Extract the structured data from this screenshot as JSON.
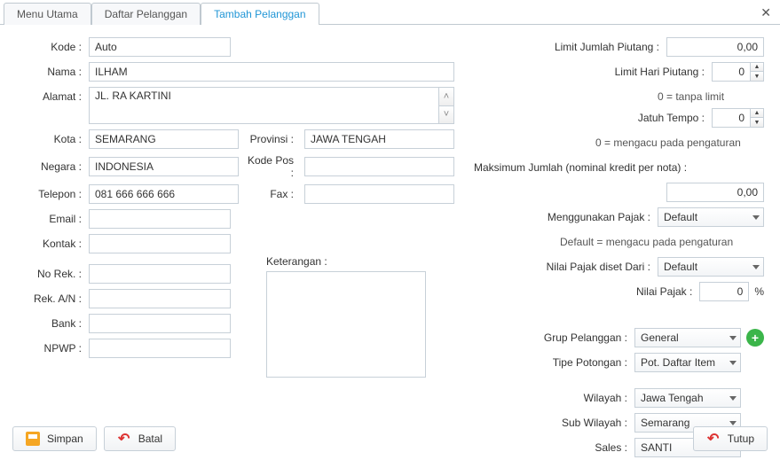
{
  "tabs": {
    "menu": "Menu Utama",
    "daftar": "Daftar Pelanggan",
    "tambah": "Tambah Pelanggan"
  },
  "labels": {
    "kode": "Kode :",
    "nama": "Nama :",
    "alamat": "Alamat :",
    "kota": "Kota :",
    "provinsi": "Provinsi :",
    "negara": "Negara :",
    "kodepos": "Kode Pos :",
    "telepon": "Telepon :",
    "fax": "Fax :",
    "email": "Email :",
    "kontak": "Kontak :",
    "norek": "No Rek. :",
    "rekan": "Rek. A/N :",
    "bank": "Bank :",
    "npwp": "NPWP :",
    "keterangan": "Keterangan :",
    "limit_jumlah": "Limit Jumlah Piutang :",
    "limit_hari": "Limit Hari Piutang :",
    "jatuh_tempo": "Jatuh Tempo :",
    "maks_jumlah_line": "Maksimum Jumlah (nominal kredit per nota) :",
    "menggunakan_pajak": "Menggunakan Pajak :",
    "nilai_pajak_dari": "Nilai Pajak diset Dari :",
    "nilai_pajak": "Nilai Pajak :",
    "grup": "Grup Pelanggan :",
    "tipe_potongan": "Tipe Potongan :",
    "wilayah": "Wilayah :",
    "sub_wilayah": "Sub Wilayah :",
    "sales": "Sales :"
  },
  "values": {
    "kode": "Auto",
    "nama": "ILHAM",
    "alamat": "JL. RA KARTINI",
    "kota": "SEMARANG",
    "provinsi": "JAWA TENGAH",
    "negara": "INDONESIA",
    "kodepos": "",
    "telepon": "081 666 666 666",
    "fax": "",
    "email": "",
    "kontak": "",
    "norek": "",
    "rekan": "",
    "bank": "",
    "npwp": "",
    "keterangan": "",
    "limit_jumlah": "0,00",
    "limit_hari": "0",
    "jatuh_tempo": "0",
    "maks_jumlah": "0,00",
    "menggunakan_pajak": "Default",
    "nilai_pajak_dari": "Default",
    "nilai_pajak": "0",
    "pct_sign": "%",
    "grup": "General",
    "tipe_potongan": "Pot. Daftar Item",
    "wilayah": "Jawa Tengah",
    "sub_wilayah": "Semarang",
    "sales": "SANTI"
  },
  "notes": {
    "tanpa_limit": "0 = tanpa limit",
    "mengacu_pengaturan": "0 = mengacu pada pengaturan",
    "default_mengacu": "Default = mengacu pada pengaturan"
  },
  "buttons": {
    "simpan": "Simpan",
    "batal": "Batal",
    "tutup": "Tutup"
  }
}
